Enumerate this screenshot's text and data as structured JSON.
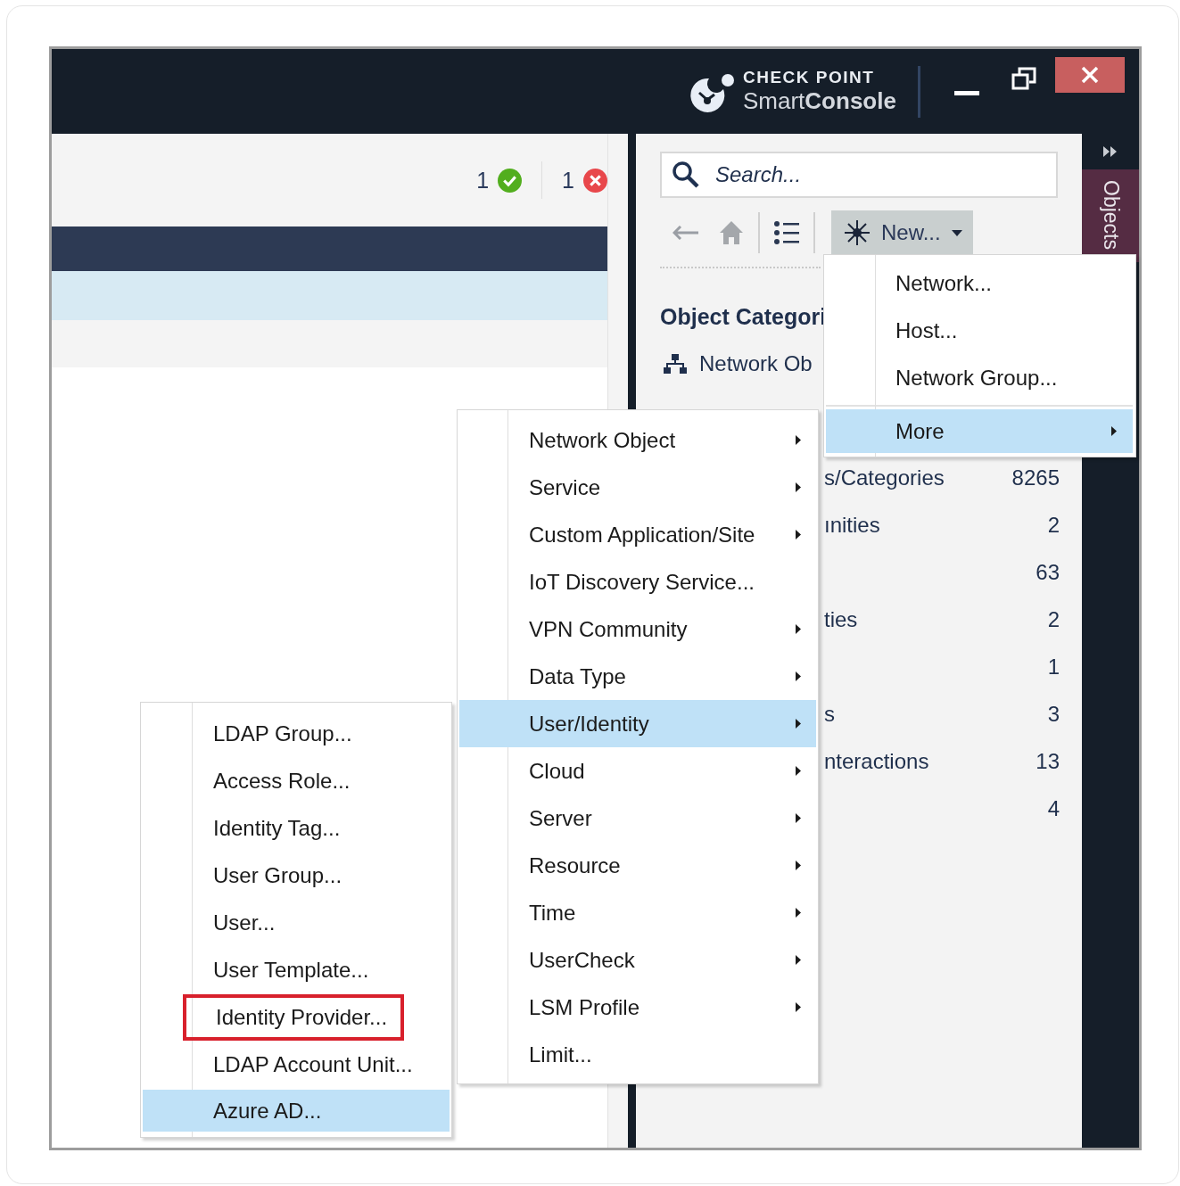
{
  "window": {
    "brand_top": "CHECK POINT",
    "brand_bottom": "Smart**Console**"
  },
  "status": [
    {
      "count": "1",
      "kind": "success"
    },
    {
      "count": "1",
      "kind": "error"
    }
  ],
  "search": {
    "placeholder": "Search..."
  },
  "toolbar": {
    "new_button": "New..."
  },
  "side_tab": {
    "label": "Objects"
  },
  "categories": {
    "heading": "Object Categori",
    "first_item": "Network Ob",
    "rows": [
      {
        "name": "s/Categories",
        "count": "8265"
      },
      {
        "name": "ınities",
        "count": "2"
      },
      {
        "name": "",
        "count": "63"
      },
      {
        "name": "ties",
        "count": "2"
      },
      {
        "name": "",
        "count": "1"
      },
      {
        "name": "s",
        "count": "3"
      },
      {
        "name": "nteractions",
        "count": "13"
      },
      {
        "name": "",
        "count": "4"
      }
    ]
  },
  "new_menu": [
    {
      "label": "Network...",
      "submenu": false,
      "selected": false
    },
    {
      "label": "Host...",
      "submenu": false,
      "selected": false
    },
    {
      "label": "Network Group...",
      "submenu": false,
      "selected": false
    },
    {
      "label": "More",
      "submenu": true,
      "selected": true
    }
  ],
  "more_menu": [
    {
      "label": "Network Object",
      "submenu": true,
      "selected": false
    },
    {
      "label": "Service",
      "submenu": true,
      "selected": false
    },
    {
      "label": "Custom Application/Site",
      "submenu": true,
      "selected": false
    },
    {
      "label": "IoT Discovery Service...",
      "submenu": false,
      "selected": false
    },
    {
      "label": "VPN Community",
      "submenu": true,
      "selected": false
    },
    {
      "label": "Data Type",
      "submenu": true,
      "selected": false
    },
    {
      "label": "User/Identity",
      "submenu": true,
      "selected": true
    },
    {
      "label": "Cloud",
      "submenu": true,
      "selected": false
    },
    {
      "label": "Server",
      "submenu": true,
      "selected": false
    },
    {
      "label": "Resource",
      "submenu": true,
      "selected": false
    },
    {
      "label": "Time",
      "submenu": true,
      "selected": false
    },
    {
      "label": "UserCheck",
      "submenu": true,
      "selected": false
    },
    {
      "label": "LSM Profile",
      "submenu": true,
      "selected": false
    },
    {
      "label": "Limit...",
      "submenu": false,
      "selected": false
    }
  ],
  "user_menu": [
    {
      "label": "LDAP Group...",
      "selected": false,
      "outlined": false
    },
    {
      "label": "Access Role...",
      "selected": false,
      "outlined": false
    },
    {
      "label": "Identity Tag...",
      "selected": false,
      "outlined": false
    },
    {
      "label": "User Group...",
      "selected": false,
      "outlined": false
    },
    {
      "label": "User...",
      "selected": false,
      "outlined": false
    },
    {
      "label": "User Template...",
      "selected": false,
      "outlined": false
    },
    {
      "label": "Identity Provider...",
      "selected": false,
      "outlined": true
    },
    {
      "label": "LDAP Account Unit...",
      "selected": false,
      "outlined": false
    },
    {
      "label": "Azure AD...",
      "selected": true,
      "outlined": false
    }
  ]
}
